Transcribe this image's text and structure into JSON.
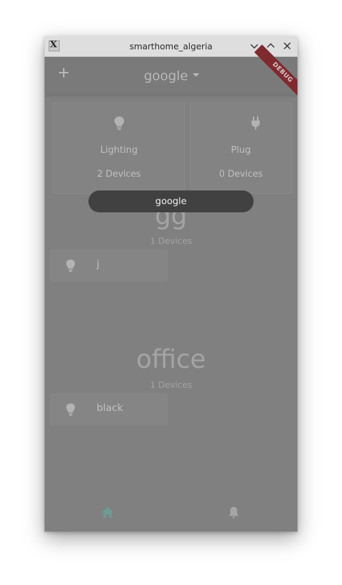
{
  "window": {
    "title": "smarthome_algeria",
    "controls": {
      "minimize": "chevron-down-icon",
      "maximize": "chevron-up-icon",
      "close": "close-icon"
    }
  },
  "appbar": {
    "add_icon": "plus-icon",
    "selected_home": "google",
    "debug_banner": "DEBUG"
  },
  "categories": [
    {
      "icon": "lightbulb-icon",
      "name": "Lighting",
      "count": "2 Devices"
    },
    {
      "icon": "plug-icon",
      "name": "Plug",
      "count": "0 Devices"
    }
  ],
  "rooms": [
    {
      "name": "gg",
      "count": "1 Devices",
      "devices": [
        {
          "icon": "lightbulb-icon",
          "name": "j"
        }
      ]
    },
    {
      "name": "office",
      "count": "1 Devices",
      "devices": [
        {
          "icon": "lightbulb-icon",
          "name": "black"
        }
      ]
    }
  ],
  "toast": {
    "text": "google"
  },
  "bottom_nav": {
    "items": [
      {
        "icon": "home-icon",
        "active": true
      },
      {
        "icon": "bell-icon",
        "active": false
      }
    ]
  },
  "colors": {
    "background": "#808080",
    "accent": "#6f9a93",
    "debug_ribbon": "#7f2a2f",
    "toast_bg": "#414141"
  }
}
